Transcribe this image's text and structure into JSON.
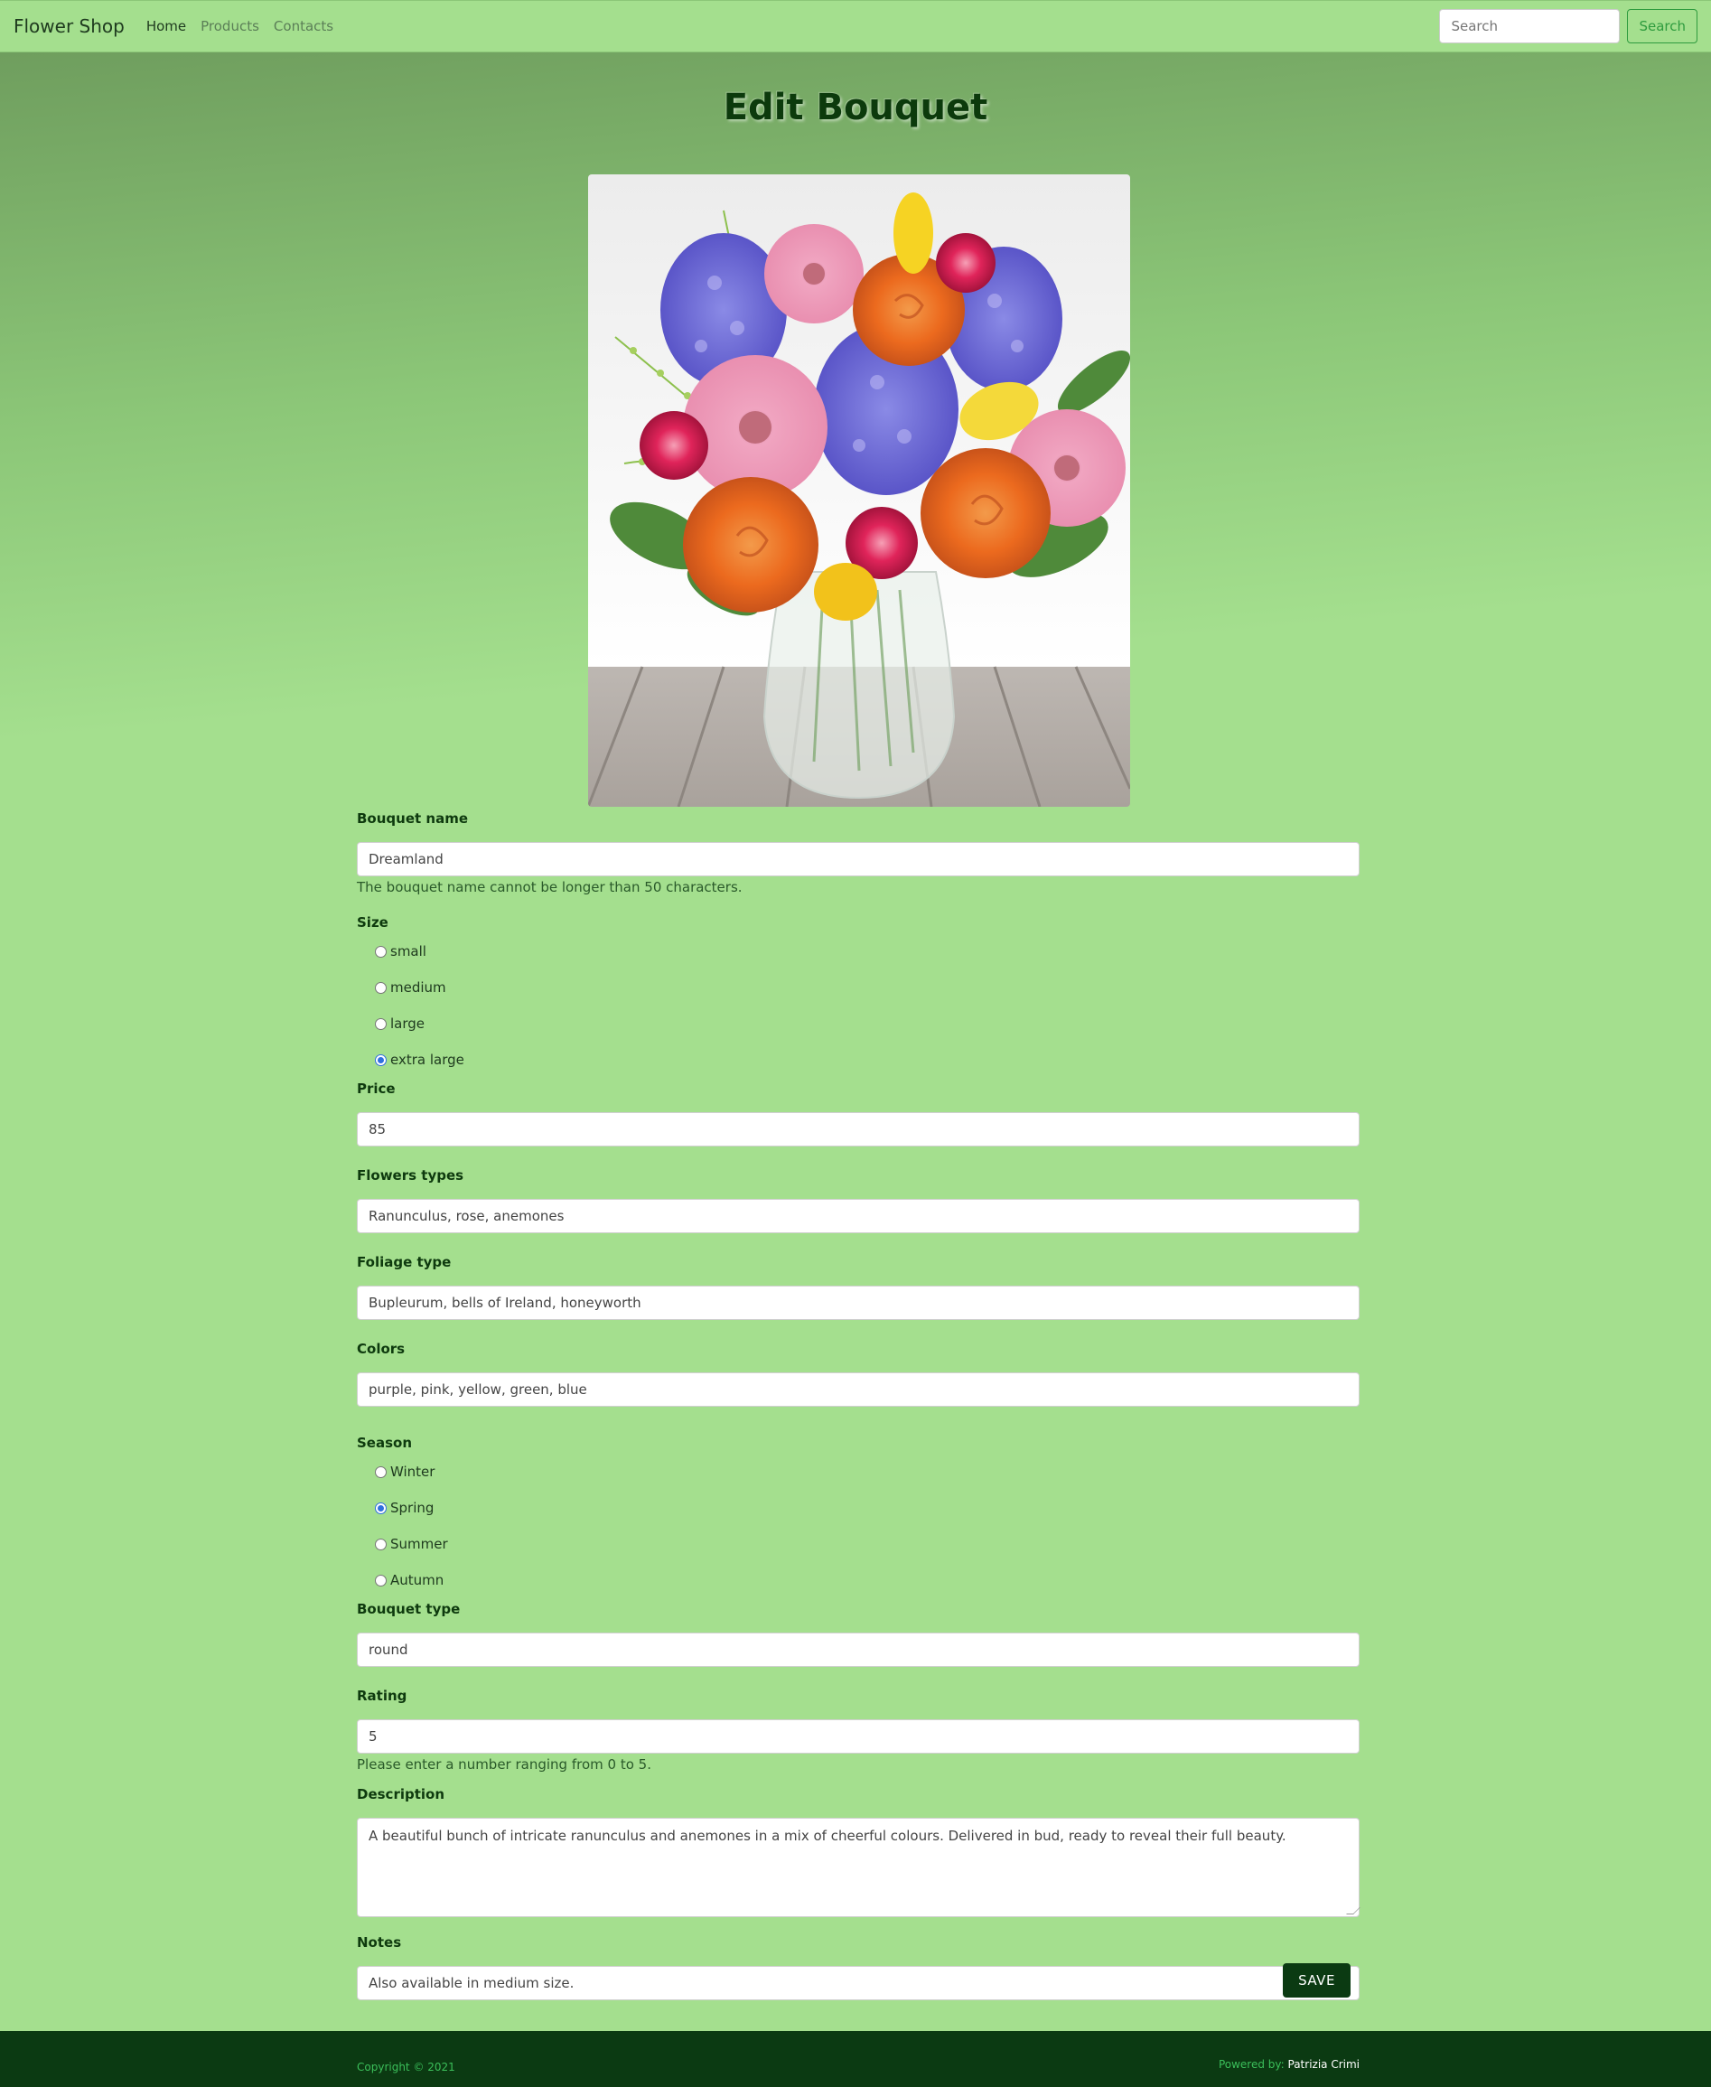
{
  "navbar": {
    "brand": "Flower Shop",
    "links": [
      "Home",
      "Products",
      "Contacts"
    ],
    "search_placeholder": "Search",
    "search_button": "Search"
  },
  "page": {
    "title": "Edit Bouquet"
  },
  "image": {
    "alt": "bouquet of roses, gerberas, hyacinths and tulips in a glass vase"
  },
  "form": {
    "name_label": "Bouquet name",
    "name_value": "Dreamland",
    "name_help": "The bouquet name cannot be longer than 50 characters.",
    "size_label": "Size",
    "size_options": [
      "small",
      "medium",
      "large",
      "extra large"
    ],
    "size_selected": "extra large",
    "price_label": "Price",
    "price_value": "85",
    "flowers_label": "Flowers types",
    "flowers_value": "Ranunculus, rose, anemones",
    "foliage_label": "Foliage type",
    "foliage_value": "Bupleurum, bells of Ireland, honeyworth",
    "colors_label": "Colors",
    "colors_value": "purple, pink, yellow, green, blue",
    "season_label": "Season",
    "season_options": [
      "Winter",
      "Spring",
      "Summer",
      "Autumn"
    ],
    "season_selected": "Spring",
    "type_label": "Bouquet type",
    "type_value": "round",
    "rating_label": "Rating",
    "rating_value": "5",
    "rating_help": "Please enter a number ranging from 0 to 5.",
    "description_label": "Description",
    "description_value": "A beautiful bunch of intricate ranunculus and anemones in a mix of cheerful colours. Delivered in bud, ready to reveal their full beauty.",
    "notes_label": "Notes",
    "notes_value": "Also available in medium size.",
    "save_button": "SAVE"
  },
  "footer": {
    "copyright": "Copyright © 2021",
    "powered_label": "Powered by:",
    "powered_name": "Patrizia Crimi"
  },
  "colors": {
    "background": "#a4df8e",
    "footer": "#0b3a12",
    "title": "#0c3a0c",
    "accent": "#2e9b3e"
  }
}
